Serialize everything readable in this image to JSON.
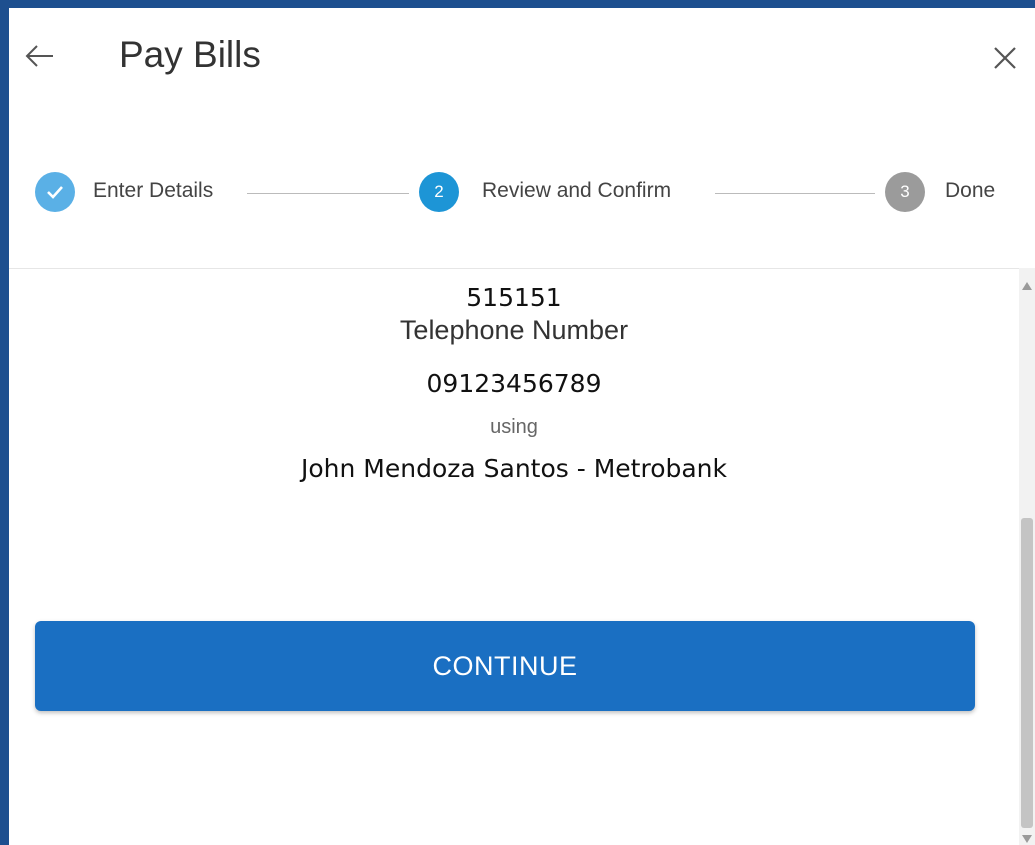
{
  "header": {
    "title": "Pay Bills",
    "back_icon": "arrow-left-icon",
    "close_icon": "close-icon"
  },
  "stepper": {
    "steps": [
      {
        "number": "",
        "label": "Enter Details",
        "state": "completed"
      },
      {
        "number": "2",
        "label": "Review and Confirm",
        "state": "active"
      },
      {
        "number": "3",
        "label": "Done",
        "state": "pending"
      }
    ],
    "colors": {
      "completed": "#5ab0e6",
      "active": "#1d95d6",
      "pending": "#9b9b9b"
    }
  },
  "review": {
    "biller_code": "515151",
    "field_label": "Telephone Number",
    "field_value": "09123456789",
    "using_label": "using",
    "account": "John Mendoza Santos - Metrobank"
  },
  "actions": {
    "continue_label": "CONTINUE",
    "accent_color": "#1a6fc2"
  }
}
